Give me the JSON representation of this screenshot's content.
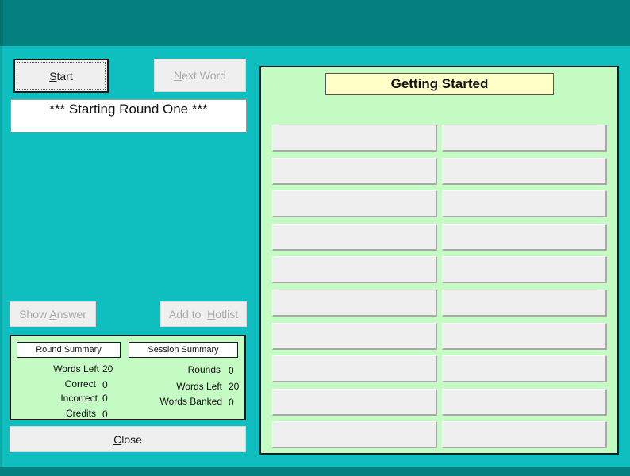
{
  "controls": {
    "start_label": "Start",
    "start_accel": "S",
    "next_word_label": "Next Word",
    "next_word_accel": "N",
    "show_answer_prefix": "Show ",
    "show_answer_accel": "A",
    "show_answer_suffix": "nswer",
    "add_hotlist_prefix": "Add to  ",
    "add_hotlist_accel": "H",
    "add_hotlist_suffix": "otlist",
    "close_label": "Close",
    "close_accel": "C"
  },
  "message": "*** Starting Round One ***",
  "round_summary": {
    "title": "Round Summary",
    "rows": [
      {
        "label": "Words Left",
        "value": "20"
      },
      {
        "label": "Correct",
        "value": "0"
      },
      {
        "label": "Incorrect",
        "value": "0"
      },
      {
        "label": "Credits",
        "value": "0"
      }
    ]
  },
  "session_summary": {
    "title": "Session Summary",
    "rows": [
      {
        "label": "Rounds",
        "value": "0"
      },
      {
        "label": "Words Left",
        "value": "20"
      },
      {
        "label": "Words Banked",
        "value": "0"
      }
    ]
  },
  "panel": {
    "title": "Getting Started",
    "slots": [
      "",
      "",
      "",
      "",
      "",
      "",
      "",
      "",
      "",
      "",
      "",
      "",
      "",
      "",
      "",
      "",
      "",
      "",
      "",
      ""
    ]
  },
  "colors": {
    "background": "#0fbfbf",
    "titlebar": "#058080",
    "panel": "#c4fcc4",
    "panel_title": "#ffffc8"
  }
}
